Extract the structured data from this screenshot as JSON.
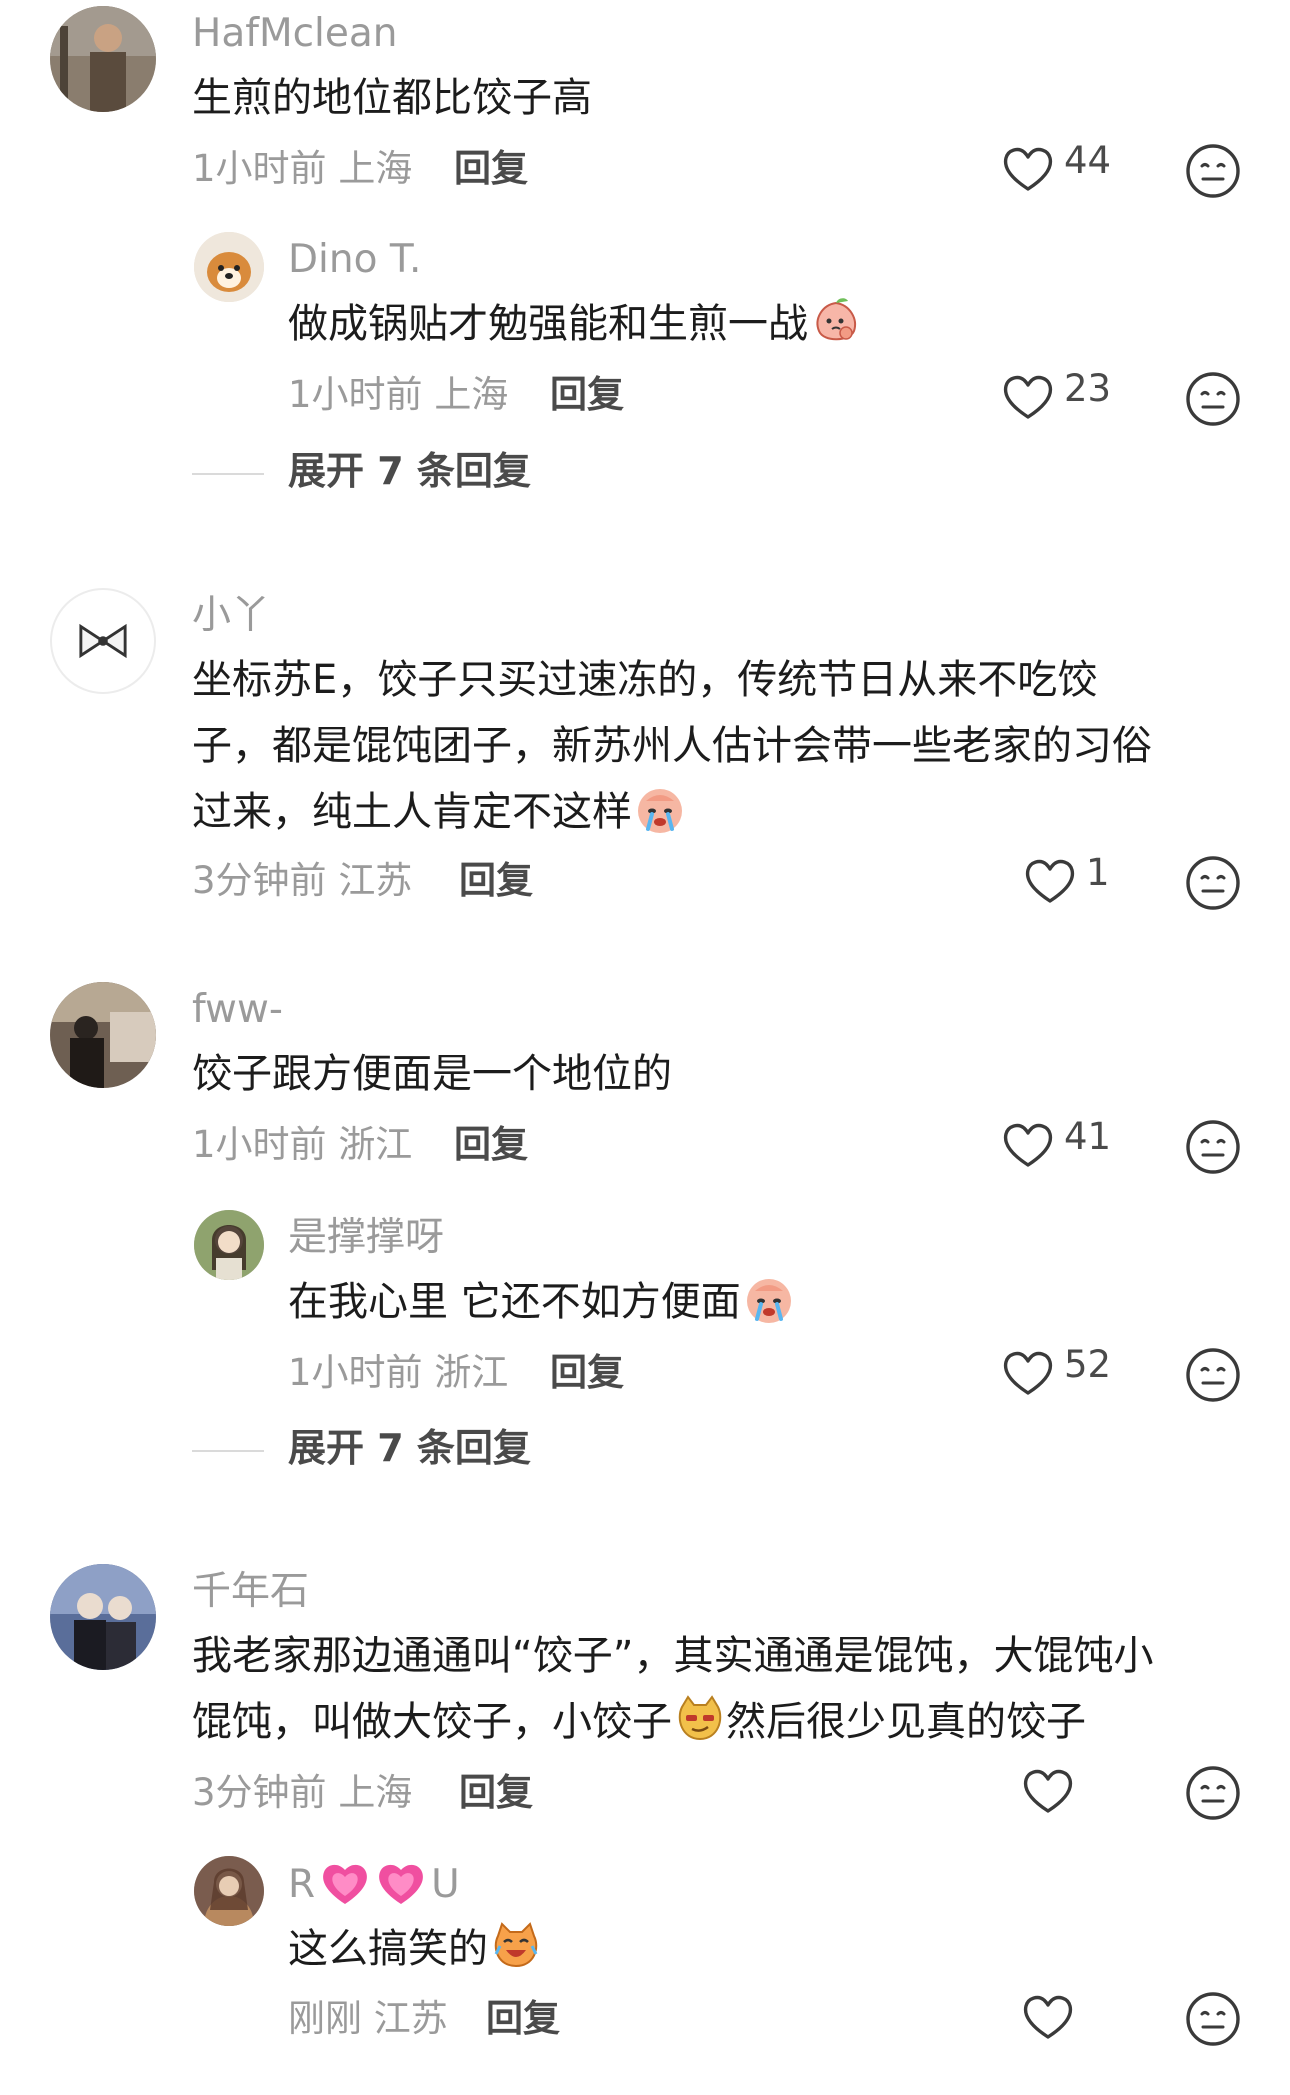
{
  "comments": [
    {
      "username": "HafMclean",
      "text_lines": [
        "生煎的地位都比饺子高"
      ],
      "time": "1小时前",
      "location": "上海",
      "reply_label": "回复",
      "likes": "44",
      "replies": [
        {
          "username": "Dino T.",
          "text_lines": [
            "做成锅贴才勉强能和生煎一战"
          ],
          "emoji": "peach-thinking-emoji",
          "time": "1小时前",
          "location": "上海",
          "reply_label": "回复",
          "likes": "23"
        }
      ],
      "expand_label": "展开 7 条回复"
    },
    {
      "username": "小丫",
      "text_lines": [
        "坐标苏E，饺子只买过速冻的，传统节日从来不吃饺",
        "子，都是馄饨团子，新苏州人估计会带一些老家的习俗",
        "过来，纯土人肯定不这样"
      ],
      "emoji": "crying-face-emoji",
      "time": "3分钟前",
      "location": "江苏",
      "reply_label": "回复",
      "likes": "1"
    },
    {
      "username": "fww-",
      "text_lines": [
        "饺子跟方便面是一个地位的"
      ],
      "time": "1小时前",
      "location": "浙江",
      "reply_label": "回复",
      "likes": "41",
      "replies": [
        {
          "username": "是撑撑呀",
          "text_lines": [
            "在我心里 它还不如方便面"
          ],
          "emoji": "crying-face-emoji",
          "time": "1小时前",
          "location": "浙江",
          "reply_label": "回复",
          "likes": "52"
        }
      ],
      "expand_label": "展开 7 条回复"
    },
    {
      "username": "千年石",
      "text_lines": [
        "我老家那边通通叫“饺子”，其实通通是馄饨，大馄饨小",
        "馄饨，叫做大饺子，小饺子",
        "然后很少见真的饺子"
      ],
      "emoji": "smirk-dog-emoji",
      "time": "3分钟前",
      "location": "上海",
      "reply_label": "回复",
      "likes": "",
      "replies": [
        {
          "username_parts": [
            "R",
            "U"
          ],
          "username_emoji": "pink-heart-emoji",
          "text_lines": [
            "这么搞笑的"
          ],
          "emoji": "laughing-cat-emoji",
          "time": "刚刚",
          "location": "江苏",
          "reply_label": "回复",
          "likes": ""
        }
      ]
    }
  ],
  "icons": {
    "like": "heart-outline-icon",
    "dislike": "neutral-face-icon"
  },
  "colors": {
    "username": "#9a9a9a",
    "text": "#1c1c1c",
    "meta": "#9a9a9a",
    "action": "#4a4a4a",
    "background": "#ffffff"
  }
}
